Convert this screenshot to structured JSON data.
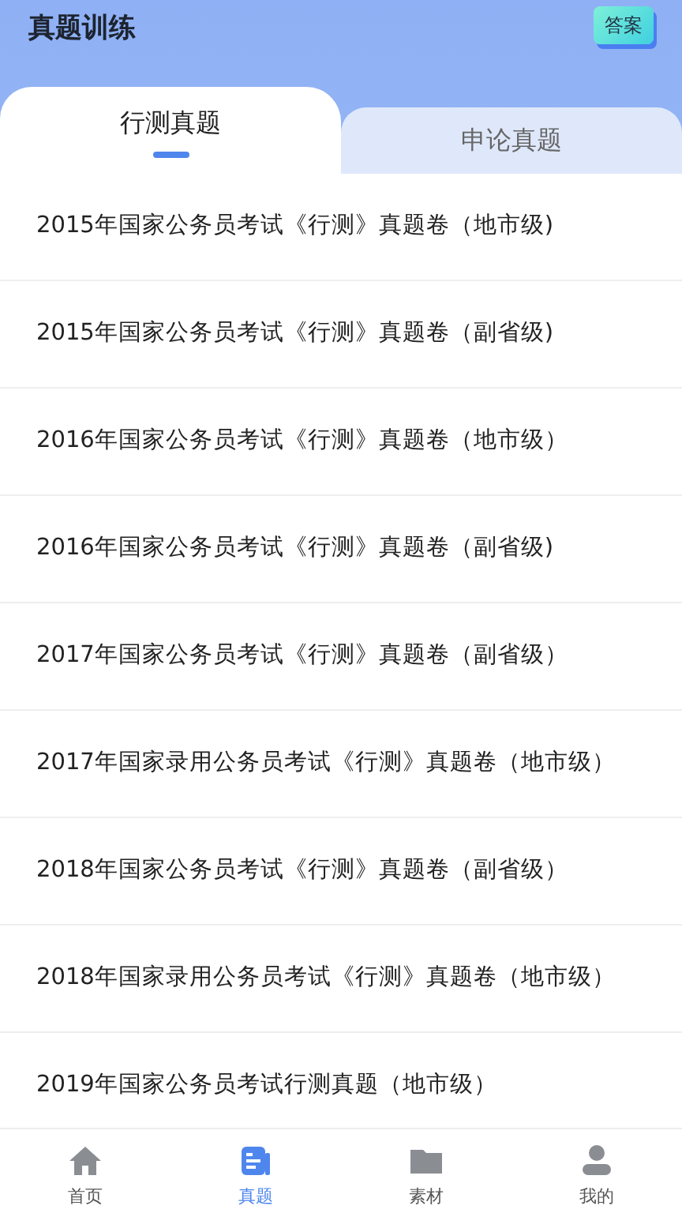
{
  "header": {
    "title": "真题训练",
    "answer_button": "答案"
  },
  "tabs": [
    {
      "label": "行测真题",
      "selected": true
    },
    {
      "label": "申论真题",
      "selected": false
    }
  ],
  "papers": [
    "2015年国家公务员考试《行测》真题卷（地市级)",
    "2015年国家公务员考试《行测》真题卷（副省级)",
    "2016年国家公务员考试《行测》真题卷（地市级）",
    "2016年国家公务员考试《行测》真题卷（副省级)",
    "2017年国家公务员考试《行测》真题卷（副省级）",
    "2017年国家录用公务员考试《行测》真题卷（地市级）",
    "2018年国家公务员考试《行测》真题卷（副省级）",
    "2018年国家录用公务员考试《行测》真题卷（地市级）",
    "2019年国家公务员考试行测真题（地市级）"
  ],
  "bottom_nav": [
    {
      "kind": "home",
      "label": "首页",
      "selected": false
    },
    {
      "kind": "papers",
      "label": "真题",
      "selected": true
    },
    {
      "kind": "folder",
      "label": "素材",
      "selected": false
    },
    {
      "kind": "profile",
      "label": "我的",
      "selected": false
    }
  ]
}
